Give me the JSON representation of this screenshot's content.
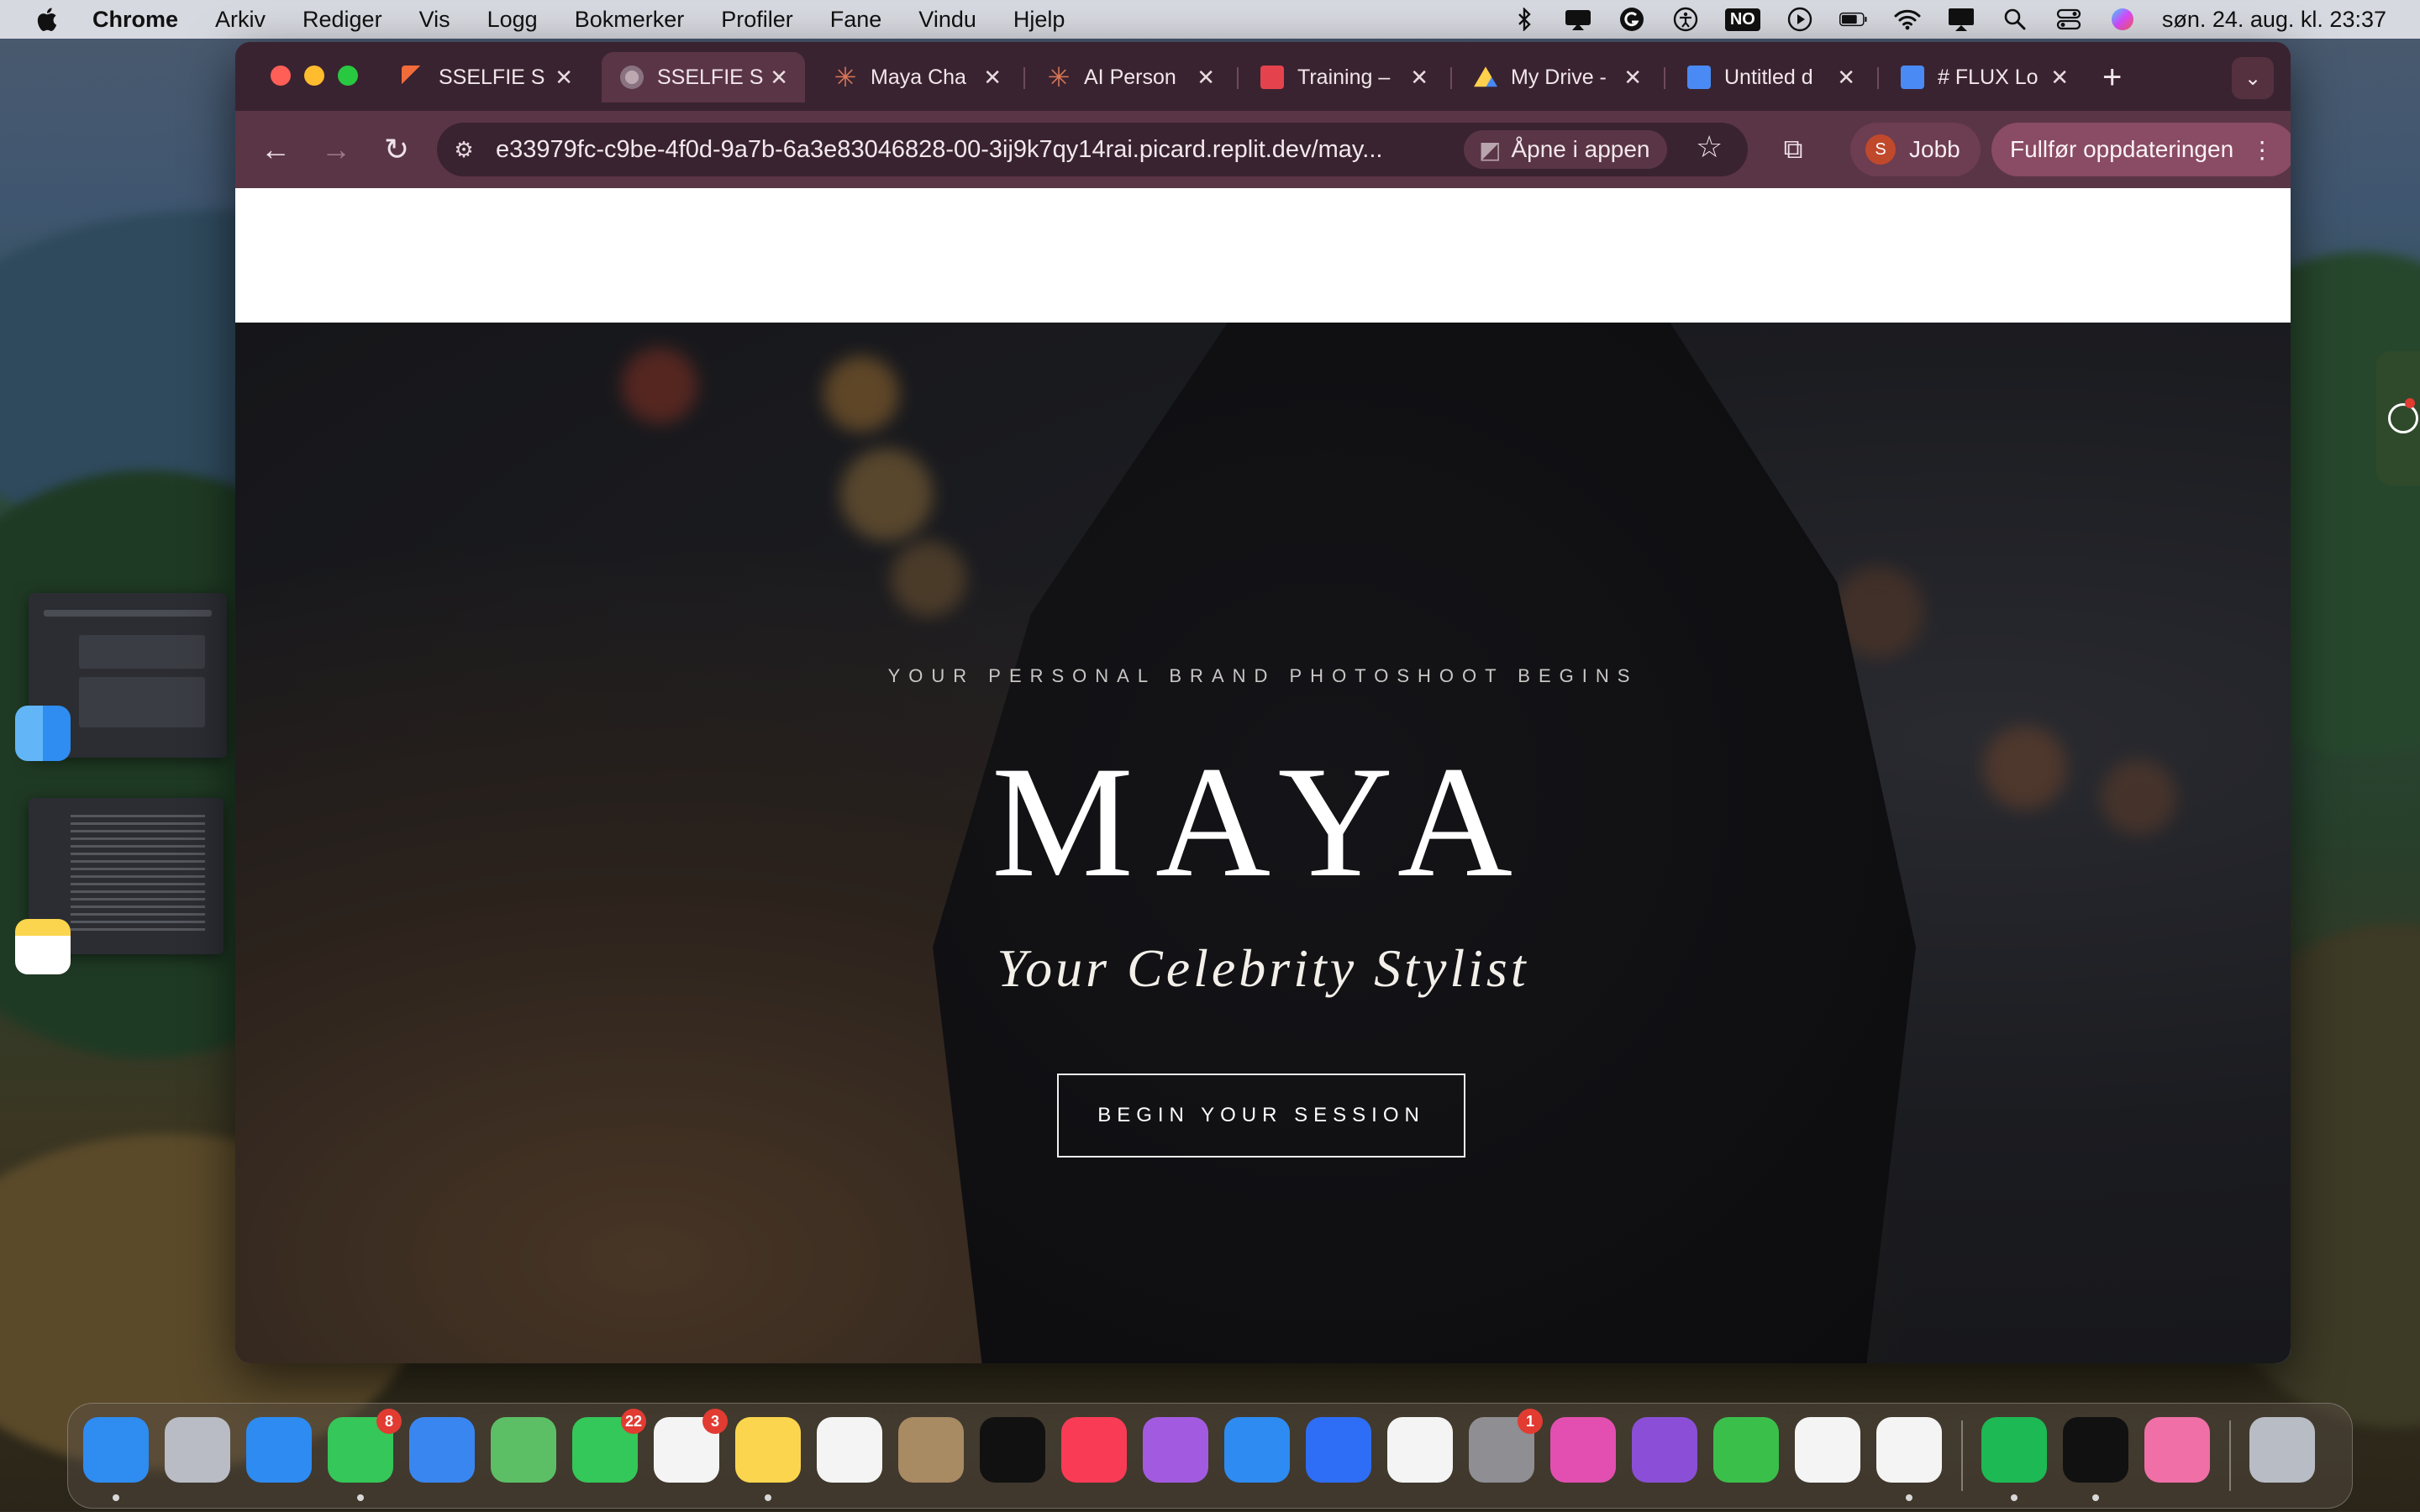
{
  "menubar": {
    "app": "Chrome",
    "items": [
      "Arkiv",
      "Rediger",
      "Vis",
      "Logg",
      "Bokmerker",
      "Profiler",
      "Fane",
      "Vindu",
      "Hjelp"
    ],
    "input_source": "NO",
    "clock": "søn. 24. aug. kl. 23:37"
  },
  "tabs": [
    {
      "label": "SSELFIE S",
      "icon": "sselfie-favicon",
      "active": false
    },
    {
      "label": "SSELFIE S",
      "icon": "globe-favicon",
      "active": true
    },
    {
      "label": "Maya Cha",
      "icon": "claude-favicon",
      "active": false
    },
    {
      "label": "AI Person",
      "icon": "claude-favicon",
      "active": false
    },
    {
      "label": "Training –",
      "icon": "training-favicon",
      "active": false
    },
    {
      "label": "My Drive -",
      "icon": "drive-favicon",
      "active": false
    },
    {
      "label": "Untitled d",
      "icon": "docs-favicon",
      "active": false
    },
    {
      "label": "# FLUX Lo",
      "icon": "docs-favicon",
      "active": false
    }
  ],
  "toolbar": {
    "url": "e33979fc-c9be-4f0d-9a7b-6a3e83046828-00-3ij9k7qy14rai.picard.replit.dev/may...",
    "open_in_app": "Åpne i appen",
    "profile_initial": "S",
    "profile_name": "Jobb",
    "update_label": "Fullfør oppdateringen"
  },
  "hero": {
    "eyebrow": "YOUR PERSONAL BRAND PHOTOSHOOT BEGINS",
    "title": "MAYA",
    "subtitle": "Your Celebrity Stylist",
    "cta": "BEGIN YOUR SESSION"
  },
  "dock": {
    "apps": [
      {
        "name": "finder",
        "color": "#2f8cf0",
        "running": true
      },
      {
        "name": "launchpad",
        "color": "#b9bcc4"
      },
      {
        "name": "safari",
        "color": "#2d8bf2"
      },
      {
        "name": "messages",
        "color": "#35c759",
        "badge": "8",
        "running": true
      },
      {
        "name": "mail",
        "color": "#3a86f0"
      },
      {
        "name": "maps",
        "color": "#5cbf66"
      },
      {
        "name": "facetime",
        "color": "#34c759",
        "badge": "22"
      },
      {
        "name": "reminders",
        "color": "#f4f4f4",
        "badge": "3"
      },
      {
        "name": "notes",
        "color": "#fbd54d",
        "running": true
      },
      {
        "name": "freeform",
        "color": "#f4f4f4"
      },
      {
        "name": "contacts",
        "color": "#a88a63"
      },
      {
        "name": "apple-tv",
        "color": "#111111"
      },
      {
        "name": "music",
        "color": "#fa3b55"
      },
      {
        "name": "podcasts",
        "color": "#a25be0"
      },
      {
        "name": "app-store",
        "color": "#2d8bf2"
      },
      {
        "name": "roblox-studio",
        "color": "#2e6df5"
      },
      {
        "name": "outlook",
        "color": "#f4f4f4"
      },
      {
        "name": "system-settings",
        "color": "#8e8e93",
        "badge": "1"
      },
      {
        "name": "keynote",
        "color": "#e34fb0"
      },
      {
        "name": "github-desktop",
        "color": "#8a4fd6"
      },
      {
        "name": "numbers",
        "color": "#3bbf4b"
      },
      {
        "name": "chatgpt",
        "color": "#f4f4f4"
      },
      {
        "name": "chrome",
        "color": "#f4f4f4",
        "running": true
      },
      {
        "name": "spotify",
        "color": "#1db954",
        "running": true
      },
      {
        "name": "cursor",
        "color": "#111111",
        "running": true
      },
      {
        "name": "preview-app",
        "color": "#f06fa7"
      },
      {
        "name": "trash",
        "color": "#b8bcc4"
      }
    ]
  }
}
